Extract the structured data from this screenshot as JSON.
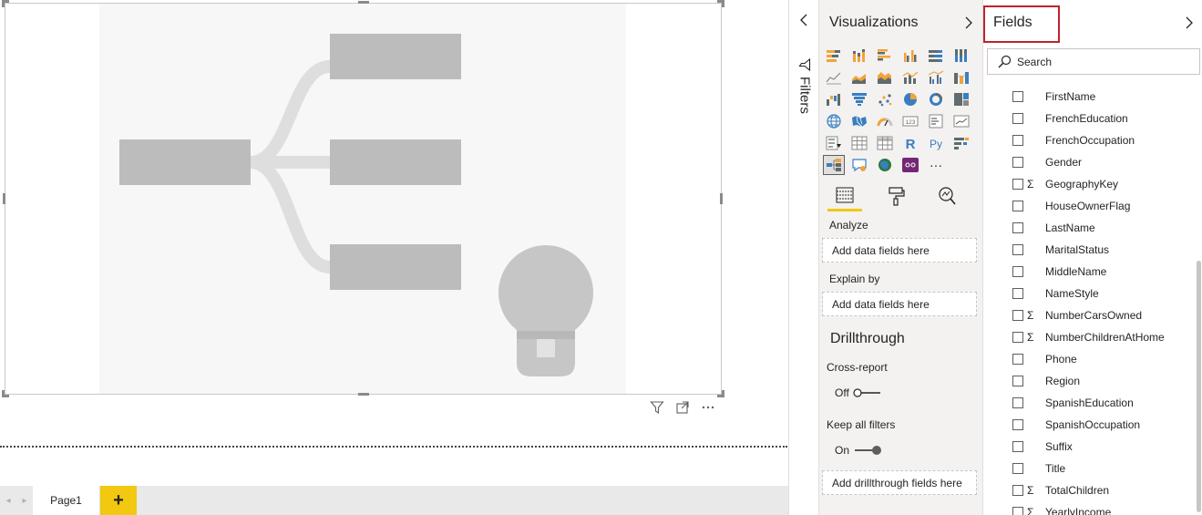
{
  "page_tabs": {
    "pages": [
      "Page1"
    ],
    "add_label": "+"
  },
  "filters": {
    "label": "Filters"
  },
  "visualizations": {
    "title": "Visualizations",
    "tabs": [
      "fields-tab",
      "format-tab",
      "analytics-tab"
    ],
    "analyze_label": "Analyze",
    "analyze_placeholder": "Add data fields here",
    "explain_label": "Explain by",
    "explain_placeholder": "Add data fields here",
    "drillthrough_title": "Drillthrough",
    "cross_report_label": "Cross-report",
    "cross_report_value": "Off",
    "keep_filters_label": "Keep all filters",
    "keep_filters_value": "On",
    "drillthrough_placeholder": "Add drillthrough fields here",
    "more_label": "···",
    "r_label": "R",
    "py_label": "Py",
    "number_label": "123"
  },
  "fields": {
    "title": "Fields",
    "search_placeholder": "Search",
    "sigma": "Σ",
    "items": [
      {
        "name": "FirstName",
        "sigma": false
      },
      {
        "name": "FrenchEducation",
        "sigma": false
      },
      {
        "name": "FrenchOccupation",
        "sigma": false
      },
      {
        "name": "Gender",
        "sigma": false
      },
      {
        "name": "GeographyKey",
        "sigma": true
      },
      {
        "name": "HouseOwnerFlag",
        "sigma": false
      },
      {
        "name": "LastName",
        "sigma": false
      },
      {
        "name": "MaritalStatus",
        "sigma": false
      },
      {
        "name": "MiddleName",
        "sigma": false
      },
      {
        "name": "NameStyle",
        "sigma": false
      },
      {
        "name": "NumberCarsOwned",
        "sigma": true
      },
      {
        "name": "NumberChildrenAtHome",
        "sigma": true
      },
      {
        "name": "Phone",
        "sigma": false
      },
      {
        "name": "Region",
        "sigma": false
      },
      {
        "name": "SpanishEducation",
        "sigma": false
      },
      {
        "name": "SpanishOccupation",
        "sigma": false
      },
      {
        "name": "Suffix",
        "sigma": false
      },
      {
        "name": "Title",
        "sigma": false
      },
      {
        "name": "TotalChildren",
        "sigma": true
      },
      {
        "name": "YearlyIncome",
        "sigma": true
      }
    ]
  },
  "colors": {
    "accent": "#f2c811",
    "highlight_border": "#c0212d",
    "placeholder_gray": "#c0c0c0"
  }
}
